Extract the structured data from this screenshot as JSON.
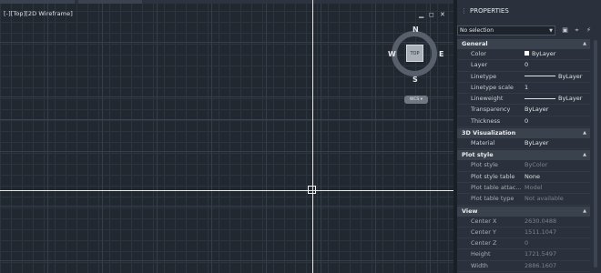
{
  "viewport": {
    "label": "[-][Top][2D Wireframe]",
    "controls": {
      "minimize": "▁",
      "maximize": "◻",
      "close": "✕"
    },
    "viewcube": {
      "top": "TOP",
      "north": "N",
      "south": "S",
      "east": "E",
      "west": "W"
    },
    "wcs_label": "WCS ▾"
  },
  "palette": {
    "title": "PROPERTIES",
    "selection": "No selection",
    "icons": [
      "toggle-pickadd-icon",
      "select-objects-icon",
      "quick-select-icon"
    ],
    "sections": [
      {
        "title": "General",
        "rows": [
          {
            "name": "Color",
            "value": "ByLayer",
            "kind": "color"
          },
          {
            "name": "Layer",
            "value": "0"
          },
          {
            "name": "Linetype",
            "value": "ByLayer",
            "kind": "line"
          },
          {
            "name": "Linetype scale",
            "value": "1"
          },
          {
            "name": "Lineweight",
            "value": "ByLayer",
            "kind": "line"
          },
          {
            "name": "Transparency",
            "value": "ByLayer"
          },
          {
            "name": "Thickness",
            "value": "0"
          }
        ]
      },
      {
        "title": "3D Visualization",
        "rows": [
          {
            "name": "Material",
            "value": "ByLayer"
          }
        ]
      },
      {
        "title": "Plot style",
        "rows": [
          {
            "name": "Plot style",
            "value": "ByColor",
            "dim": true
          },
          {
            "name": "Plot style table",
            "value": "None"
          },
          {
            "name": "Plot table attac...",
            "value": "Model",
            "dim": true
          },
          {
            "name": "Plot table type",
            "value": "Not available",
            "dim": true
          }
        ]
      },
      {
        "title": "View",
        "rows": [
          {
            "name": "Center X",
            "value": "2630.0488",
            "dim": true
          },
          {
            "name": "Center Y",
            "value": "1511.1047",
            "dim": true
          },
          {
            "name": "Center Z",
            "value": "0",
            "dim": true
          },
          {
            "name": "Height",
            "value": "1721.5497",
            "dim": true
          },
          {
            "name": "Width",
            "value": "2886.1607",
            "dim": true
          }
        ]
      },
      {
        "title": "Misc",
        "rows": []
      }
    ]
  }
}
